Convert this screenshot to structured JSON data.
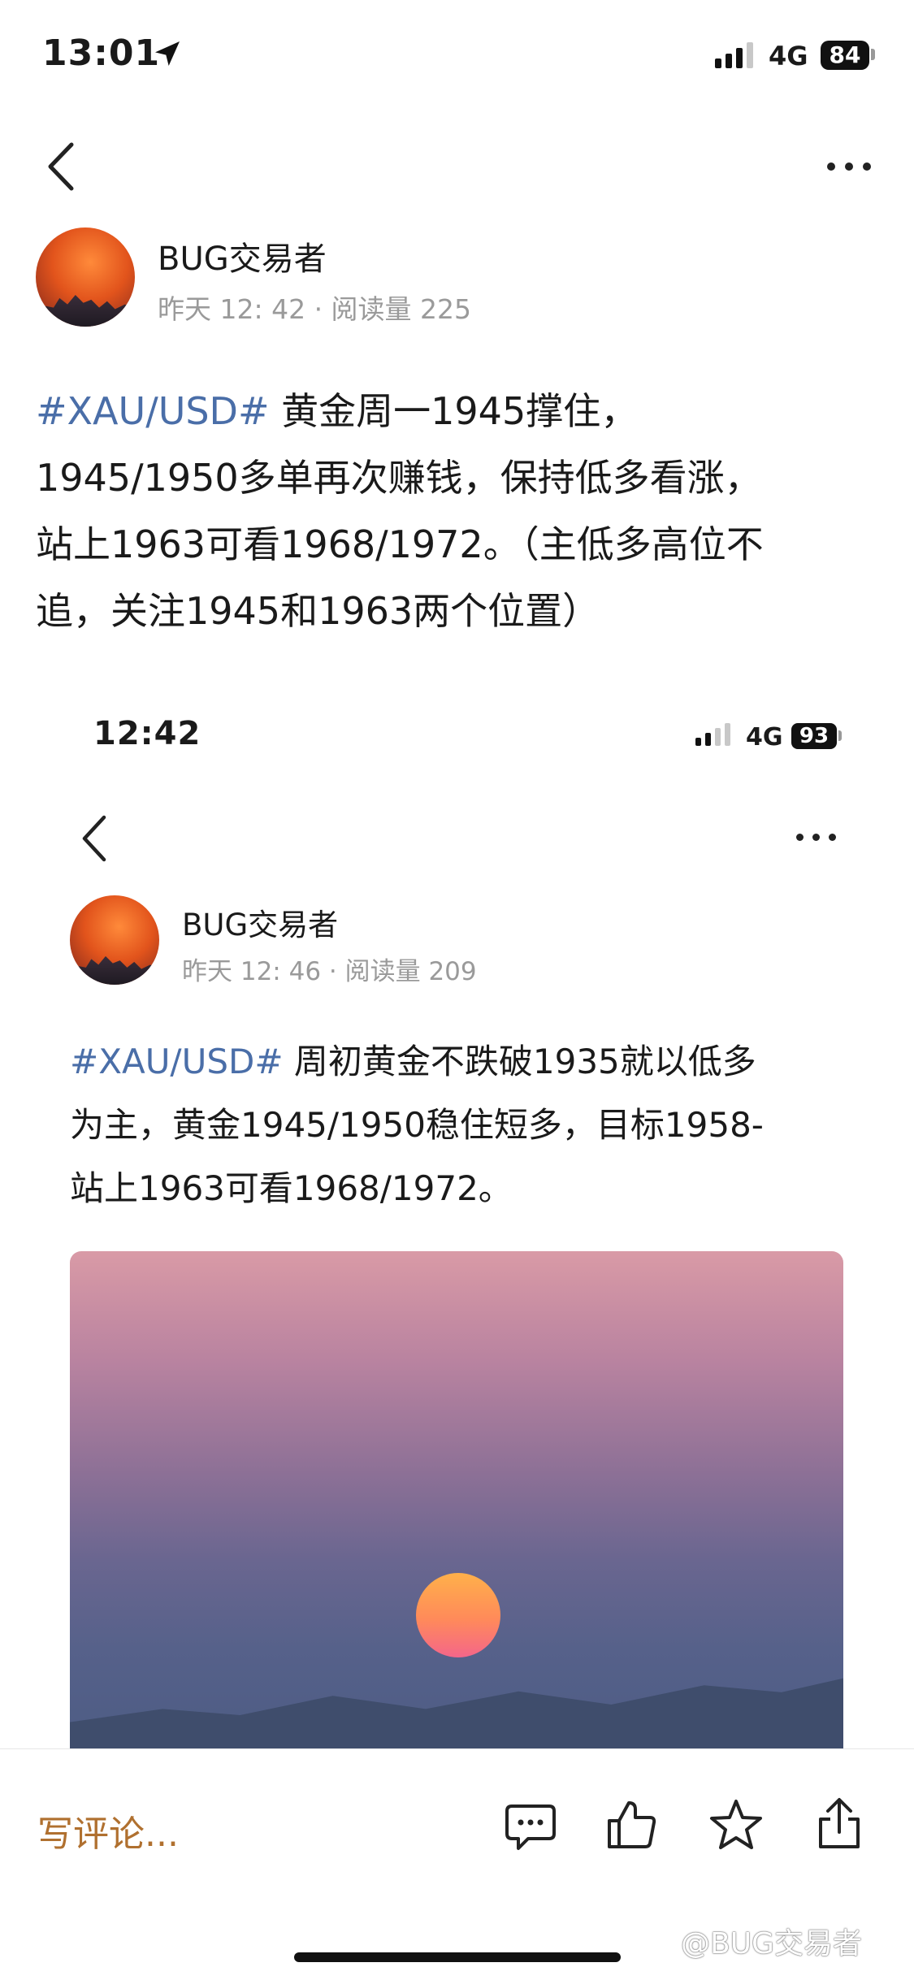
{
  "status_bar": {
    "time": "13:01",
    "network": "4G",
    "battery": "84"
  },
  "post": {
    "author": "BUG交易者",
    "meta": "昨天 12: 42 · 阅读量 225",
    "tag": "#XAU/USD#",
    "lines": [
      " 黄金周一1945撑住，",
      "1945/1950多单再次赚钱，保持低多看涨，",
      "站上1963可看1968/1972。（主低多高位不",
      "追，关注1945和1963两个位置）"
    ]
  },
  "embedded": {
    "status_bar": {
      "time": "12:42",
      "network": "4G",
      "battery": "93"
    },
    "author": "BUG交易者",
    "meta": "昨天 12: 46 · 阅读量 209",
    "tag": "#XAU/USD#",
    "lines": [
      " 周初黄金不跌破1935就以低多",
      "为主，黄金1945/1950稳住短多，目标1958-",
      "站上1963可看1968/1972。"
    ]
  },
  "bottom_bar": {
    "comment_placeholder": "写评论..."
  },
  "watermark": "@BUG交易者",
  "icons": [
    "location-arrow-icon",
    "back-chevron-icon",
    "more-dots-icon",
    "comment-icon",
    "like-icon",
    "star-icon",
    "share-icon"
  ],
  "colors": {
    "tag": "#4a6ea8",
    "comment_placeholder": "#b0702f"
  }
}
